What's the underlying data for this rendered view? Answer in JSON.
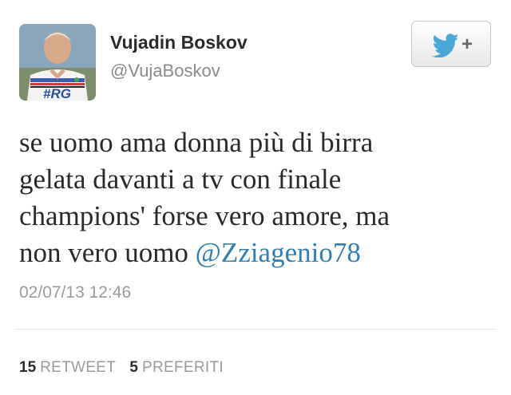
{
  "user": {
    "name": "Vujadin Boskov",
    "handle": "@VujaBoskov",
    "avatar_badge": "#RG"
  },
  "tweet": {
    "text_line1": "se uomo ama donna più di birra",
    "text_line2": "gelata davanti a tv con finale",
    "text_line3": "champions' forse vero amore, ma",
    "text_line4_pre": "non vero uomo",
    "mention": "@Zziagenio78",
    "timestamp": "02/07/13 12:46"
  },
  "follow_button": {
    "icon": "twitter-bird-icon",
    "plus": "+"
  },
  "stats": {
    "retweets_count": "15",
    "retweets_label": "RETWEET",
    "favorites_count": "5",
    "favorites_label": "PREFERITI"
  },
  "colors": {
    "mention": "#2f7fb5",
    "twitter_blue": "#4aa8d8",
    "muted": "#9b9b9b"
  }
}
